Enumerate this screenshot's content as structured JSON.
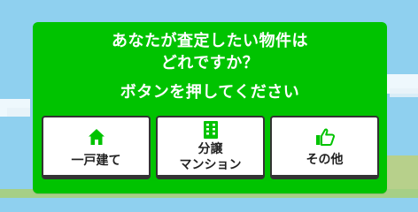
{
  "prompt": {
    "question_line1": "あなたが査定したい物件は",
    "question_line2": "どれですか？",
    "instruction": "ボタンを押してください"
  },
  "accent_color": "#00c300",
  "choices": [
    {
      "label": "一戸建て",
      "icon": "house-icon"
    },
    {
      "label": "分譲\nマンション",
      "icon": "building-icon"
    },
    {
      "label": "その他",
      "icon": "thumbs-up-icon"
    }
  ]
}
